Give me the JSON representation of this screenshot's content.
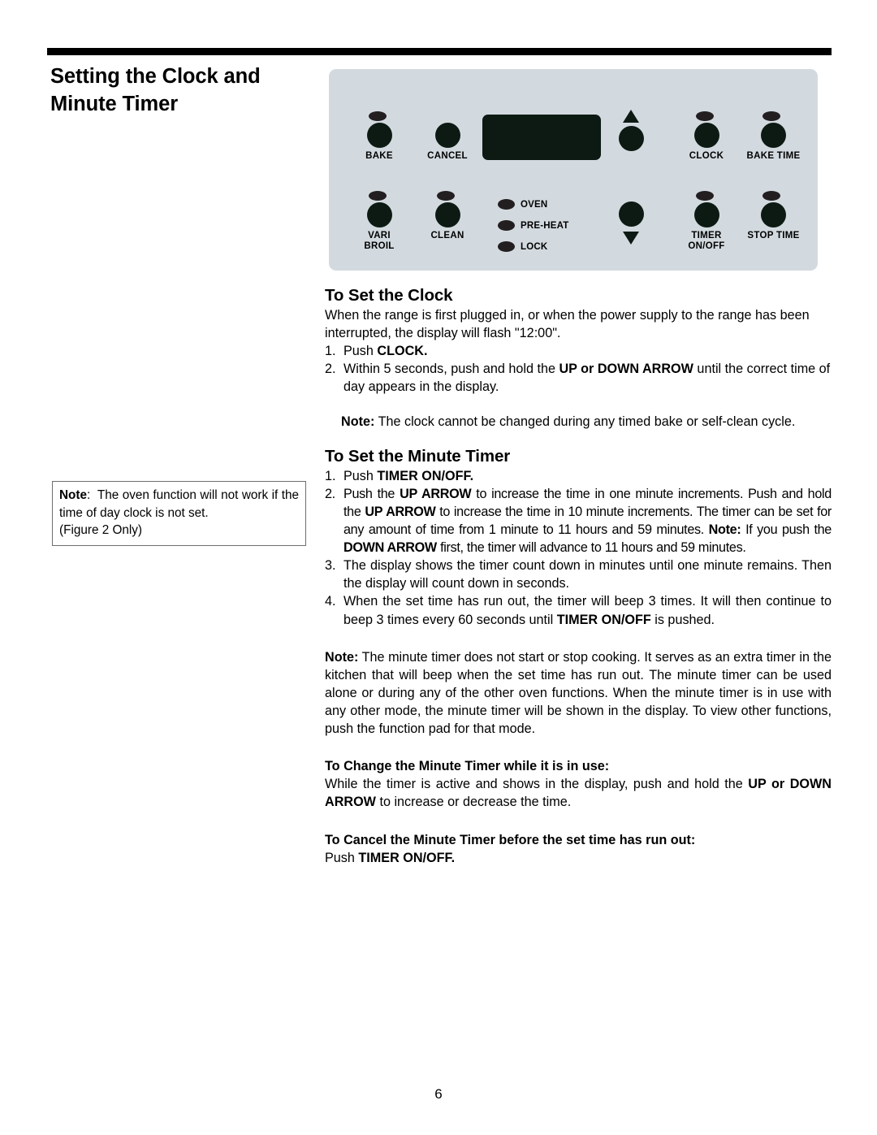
{
  "page": {
    "title_line1": "Setting the Clock and",
    "title_line2": "Minute Timer",
    "number": "6"
  },
  "colors": {
    "panel_background": "#d3dadf",
    "pad": "#0d1a14",
    "led": "#231f20",
    "note_border": "#6d6e71",
    "rule": "#000000"
  },
  "control_panel": {
    "display_window_label": "display-window",
    "pads": [
      {
        "id": "bake",
        "label": "BAKE",
        "has_led": true
      },
      {
        "id": "cancel",
        "label": "CANCEL",
        "has_led": false
      },
      {
        "id": "vari-broil",
        "label_line1": "VARI",
        "label_line2": "BROIL",
        "has_led": true
      },
      {
        "id": "clean",
        "label": "CLEAN",
        "has_led": true
      },
      {
        "id": "up-arrow",
        "label": "",
        "icon": "triangle-up-icon",
        "has_led": false
      },
      {
        "id": "down-arrow",
        "label": "",
        "icon": "triangle-down-icon",
        "has_led": false
      },
      {
        "id": "clock",
        "label": "CLOCK",
        "has_led": true
      },
      {
        "id": "bake-time",
        "label": "BAKE TIME",
        "has_led": true
      },
      {
        "id": "timer-on-off",
        "label_line1": "TIMER",
        "label_line2": "ON/OFF",
        "has_led": true
      },
      {
        "id": "stop-time",
        "label": "STOP TIME",
        "has_led": true
      }
    ],
    "indicators": [
      {
        "id": "oven",
        "label": "OVEN"
      },
      {
        "id": "pre-heat",
        "label": "PRE-HEAT"
      },
      {
        "id": "lock",
        "label": "LOCK"
      }
    ]
  },
  "note_box": {
    "label": "Note",
    "colon": ":",
    "text_line1": "The oven function will not work",
    "text_line2": "if the time of day clock is not set.",
    "text_line3": "(Figure 2 Only)"
  },
  "sections": {
    "clock": {
      "heading": "To Set the Clock",
      "intro": "When the range is first plugged in, or when the power supply to the range has been interrupted, the display will flash \"12:00\".",
      "steps": [
        {
          "num": "1.",
          "pre": "Push ",
          "bold": "CLOCK.",
          "post": ""
        },
        {
          "num": "2.",
          "pre": "Within 5 seconds, push and hold the ",
          "bold": "UP or DOWN ARROW",
          "post": " until the correct time of day appears in the display."
        }
      ],
      "note_label": "Note:",
      "note_text": " The clock cannot be changed during any timed bake or self-clean cycle."
    },
    "minute_timer": {
      "heading": "To Set the Minute Timer",
      "step1_num": "1.",
      "step1_pre": "Push ",
      "step1_bold": "TIMER ON/OFF.",
      "step2_num": "2.",
      "step2_a": "Push the ",
      "step2_b1": "UP ARROW",
      "step2_c": " to increase the time in one minute increments. Push and hold the ",
      "step2_b2": "UP ARROW",
      "step2_d": " to increase the time in 10 minute increments. The timer can be set for any amount of time from 1 minute to 11 hours and 59 minutes. ",
      "step2_note_label": "Note:",
      "step2_e": " If you push the ",
      "step2_b3": "DOWN ARROW",
      "step2_f": " first, the timer will advance to 11 hours and 59 minutes.",
      "step3_num": "3.",
      "step3_text": "The display shows the timer count down in minutes until one minute remains. Then the display will count down in seconds.",
      "step4_num": "4.",
      "step4_a": "When the set time has run out, the timer will beep 3 times. It will then continue to beep 3 times every 60 seconds until ",
      "step4_b": "TIMER ON/OFF",
      "step4_c": " is pushed.",
      "note_label": "Note:",
      "note_text": "  The minute timer does not start or stop cooking. It serves as an extra timer in the kitchen that will beep when the set time has run out. The minute timer can be used alone or during any of the other oven functions. When the minute timer is in use with any other mode, the minute timer will be shown in the display. To view other functions, push the function pad for that mode."
    },
    "change_timer": {
      "heading": "To Change the Minute Timer while it is in use:",
      "body_a": "While the timer is active and shows in the display, push and hold the ",
      "body_b": "UP or DOWN ARROW",
      "body_c": " to increase or decrease the time."
    },
    "cancel_timer": {
      "heading": "To Cancel the Minute Timer before the set time has run out:",
      "body_a": "Push ",
      "body_b": "TIMER ON/OFF."
    }
  }
}
